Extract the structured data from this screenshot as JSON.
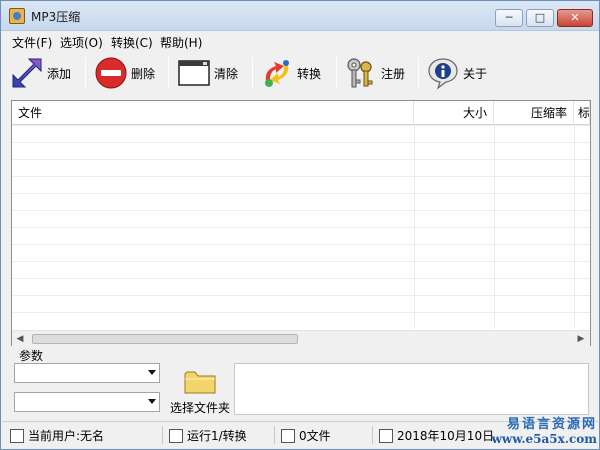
{
  "window": {
    "title": "MP3压缩",
    "controls": {
      "minimize": "─",
      "maximize": "□",
      "close": "✕"
    }
  },
  "menu": {
    "items": [
      {
        "label": "文件(F)"
      },
      {
        "label": "选项(O)"
      },
      {
        "label": "转换(C)"
      },
      {
        "label": "帮助(H)"
      }
    ]
  },
  "toolbar": {
    "add": "添加",
    "delete": "删除",
    "clear": "清除",
    "convert": "转换",
    "register": "注册",
    "about": "关于"
  },
  "table": {
    "columns": [
      {
        "label": "文件"
      },
      {
        "label": "大小"
      },
      {
        "label": "压缩率"
      },
      {
        "label": "标"
      }
    ],
    "rows": []
  },
  "params": {
    "label": "参数",
    "combo1_value": "",
    "combo2_value": "",
    "choose_folder": "选择文件夹",
    "text_value": ""
  },
  "status": {
    "current_user": "当前用户:无名",
    "running": "运行1/转换",
    "files": "0文件",
    "date": "2018年10月10日"
  },
  "watermark": {
    "line1": "易语言资源网",
    "line2": "www.e5a5x.com"
  },
  "colors": {
    "accent_titlebar": "#c7d8ec",
    "close_button": "#c74535",
    "delete_icon": "#d92b2b",
    "watermark": "#2a6ab8"
  }
}
